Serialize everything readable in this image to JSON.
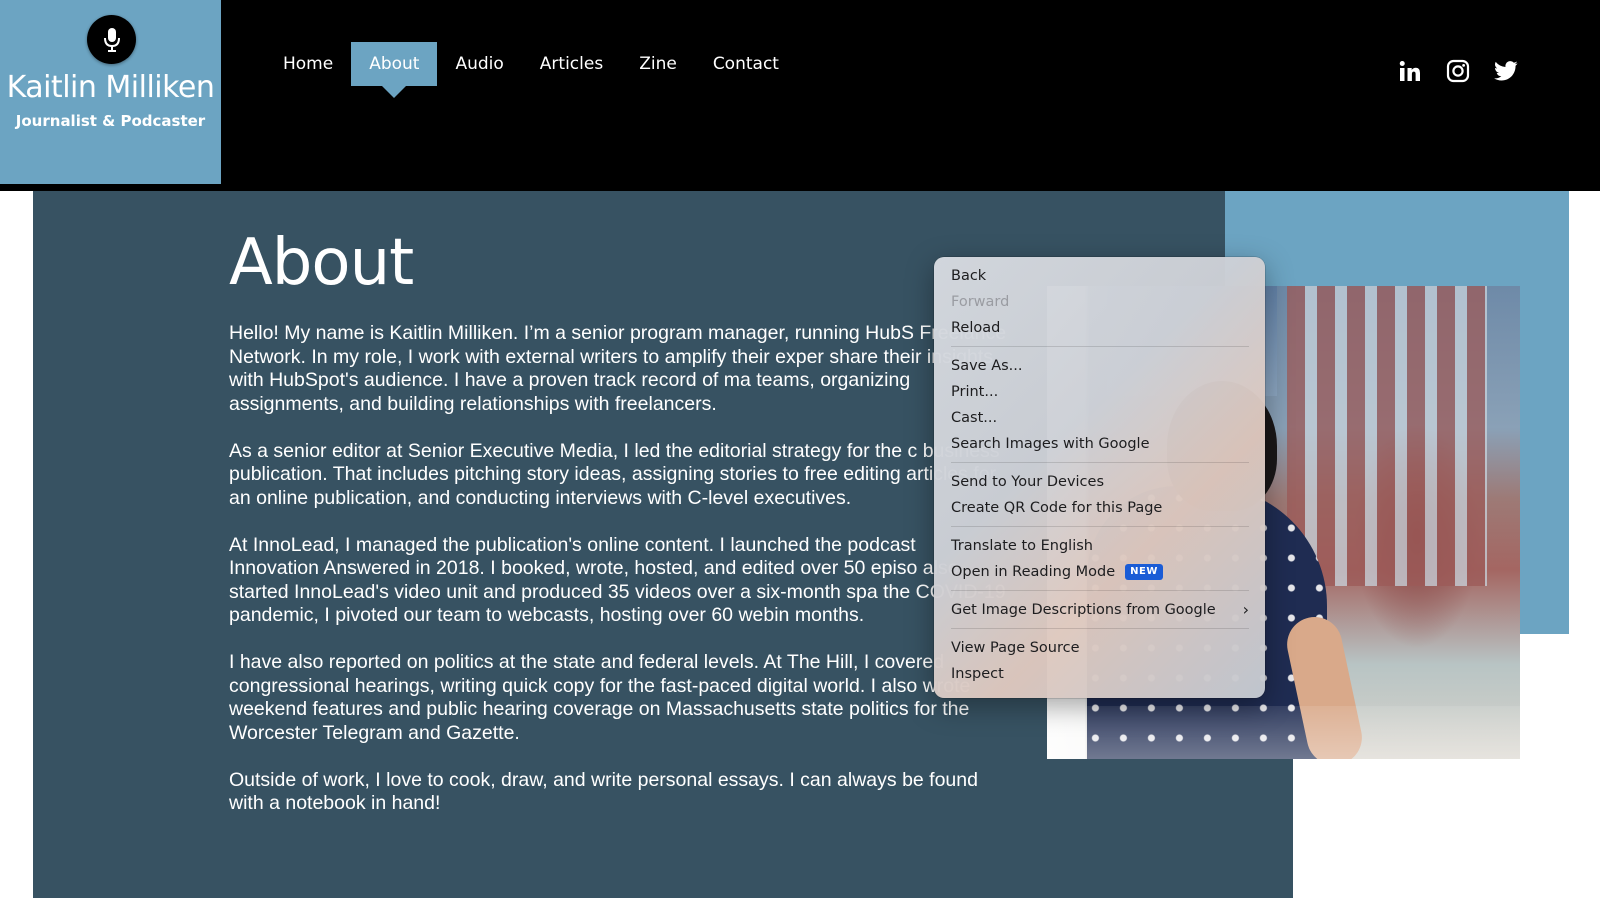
{
  "site": {
    "name": "Kaitlin Milliken",
    "tagline": "Journalist & Podcaster",
    "logo_icon": "microphone-icon",
    "brand_colors": {
      "header_bg": "#000000",
      "accent": "#6ca4c2",
      "panel_dark": "#375262"
    }
  },
  "nav": {
    "items": [
      {
        "label": "Home",
        "active": false
      },
      {
        "label": "About",
        "active": true
      },
      {
        "label": "Audio",
        "active": false
      },
      {
        "label": "Articles",
        "active": false
      },
      {
        "label": "Zine",
        "active": false
      },
      {
        "label": "Contact",
        "active": false
      }
    ]
  },
  "social": [
    {
      "name": "linkedin-icon",
      "label": "in"
    },
    {
      "name": "instagram-icon"
    },
    {
      "name": "twitter-icon"
    }
  ],
  "page": {
    "title": "About",
    "paragraphs": [
      "Hello! My name is Kaitlin Milliken. I’m a senior program manager, running HubS Freelance Network. In my role, I work with external writers to amplify their exper share their insights with HubSpot's audience. I have a proven track record of ma teams, organizing assignments, and building relationships with freelancers.",
      "As a senior editor at Senior Executive Media, I led the editorial strategy for the c business publication. That includes pitching story ideas, assigning stories to free editing articles for an online publication, and conducting interviews with C-level executives.",
      "At InnoLead, I managed the publication's online content. I launched the podcast Innovation Answered in 2018. I booked, wrote, hosted, and edited over 50 episo also started InnoLead's video unit and produced 35 videos over a six-month spa the COVID-19 pandemic, I pivoted our team to webcasts, hosting over 60 webin months.",
      "I have also reported on politics at the state and federal levels. At The Hill, I covered congressional hearings, writing quick copy for the fast-paced digital world. I also wrote weekend features and public hearing coverage on Massachusetts state politics for the Worcester Telegram and Gazette.",
      "Outside of work, I love to cook, draw, and write personal essays. I can always be found with a notebook in hand!"
    ]
  },
  "context_menu": {
    "groups": [
      [
        {
          "label": "Back",
          "disabled": false
        },
        {
          "label": "Forward",
          "disabled": true
        },
        {
          "label": "Reload",
          "disabled": false
        }
      ],
      [
        {
          "label": "Save As..."
        },
        {
          "label": "Print..."
        },
        {
          "label": "Cast..."
        },
        {
          "label": "Search Images with Google"
        }
      ],
      [
        {
          "label": "Send to Your Devices"
        },
        {
          "label": "Create QR Code for this Page"
        }
      ],
      [
        {
          "label": "Translate to English"
        },
        {
          "label": "Open in Reading Mode",
          "badge": "NEW"
        }
      ],
      [
        {
          "label": "Get Image Descriptions from Google",
          "submenu": true
        }
      ],
      [
        {
          "label": "View Page Source"
        },
        {
          "label": "Inspect"
        }
      ]
    ],
    "badge_color": "#1a5cd6"
  }
}
